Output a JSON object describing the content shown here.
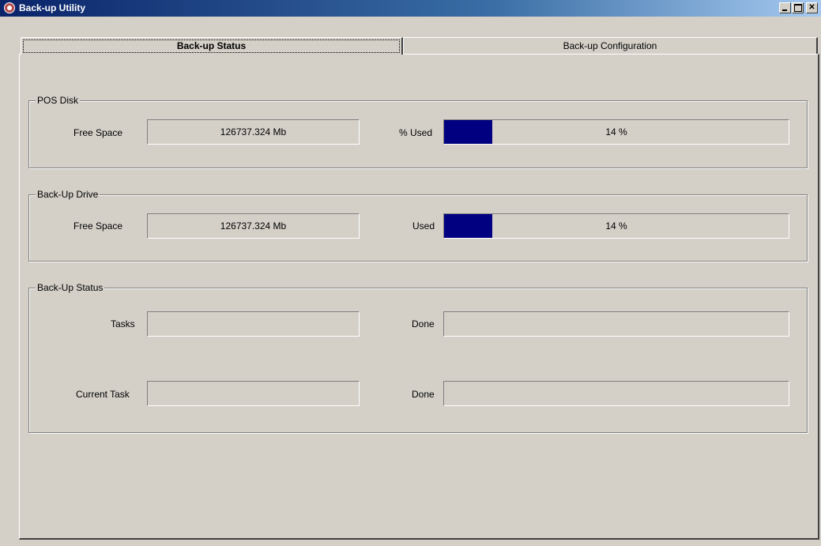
{
  "window": {
    "title": "Back-up Utility"
  },
  "tabs": [
    {
      "label": "Back-up Status",
      "active": true
    },
    {
      "label": "Back-up Configuration",
      "active": false
    }
  ],
  "pos_disk": {
    "title": "POS Disk",
    "free_space_label": "Free Space",
    "free_space_value": "126737.324 Mb",
    "used_label": "% Used",
    "used_percent": 14,
    "used_text": "14 %"
  },
  "backup_drive": {
    "title": "Back-Up Drive",
    "free_space_label": "Free Space",
    "free_space_value": "126737.324 Mb",
    "used_label": "Used",
    "used_percent": 14,
    "used_text": "14 %"
  },
  "backup_status": {
    "title": "Back-Up Status",
    "tasks_label": "Tasks",
    "tasks_value": "",
    "tasks_done_label": "Done",
    "tasks_done_value": "",
    "current_task_label": "Current Task",
    "current_task_value": "",
    "current_done_label": "Done",
    "current_done_value": ""
  },
  "colors": {
    "progress_fill": "#000080",
    "face": "#d4d0c8",
    "titlebar_start": "#0a246a"
  },
  "icons": [
    "app-icon",
    "minimize-icon",
    "maximize-icon",
    "close-icon"
  ]
}
